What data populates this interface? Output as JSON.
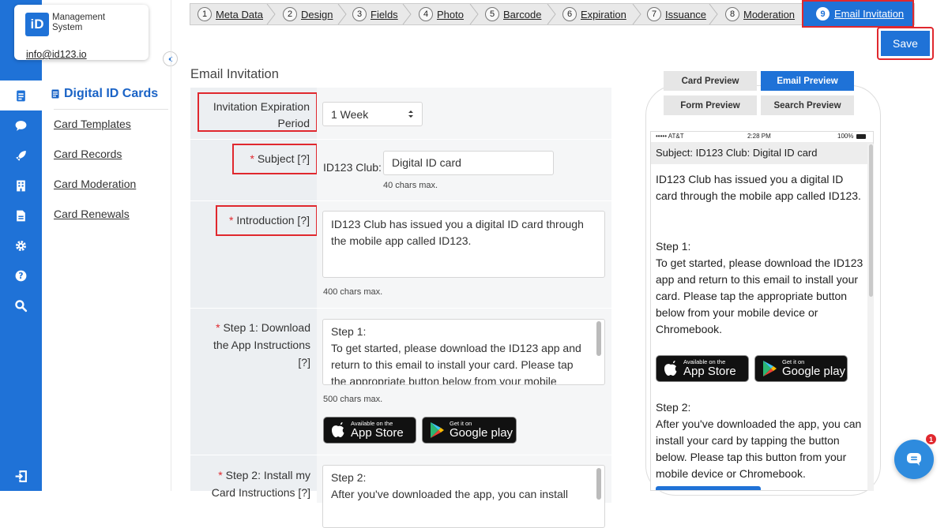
{
  "brand": {
    "logo_text": "iD",
    "title": "Management System",
    "email": "info@id123.io"
  },
  "rail": {
    "icons": [
      "card-icon",
      "chat-icon",
      "rocket-icon",
      "building-icon",
      "document-icon",
      "gear-icon",
      "help-icon",
      "search-icon",
      "logout-icon"
    ],
    "active": "card-icon",
    "bg_color": "#1f72d7"
  },
  "sidebar": {
    "heading": "Digital ID Cards",
    "items": [
      "Card Templates",
      "Card Records",
      "Card Moderation",
      "Card Renewals"
    ]
  },
  "steps": [
    {
      "num": "1",
      "label": "Meta Data"
    },
    {
      "num": "2",
      "label": "Design"
    },
    {
      "num": "3",
      "label": "Fields"
    },
    {
      "num": "4",
      "label": "Photo"
    },
    {
      "num": "5",
      "label": "Barcode"
    },
    {
      "num": "6",
      "label": "Expiration"
    },
    {
      "num": "7",
      "label": "Issuance"
    },
    {
      "num": "8",
      "label": "Moderation"
    },
    {
      "num": "9",
      "label": "Email Invitation"
    }
  ],
  "active_step": "9",
  "save_label": "Save",
  "section_title": "Email Invitation",
  "form": {
    "expiration": {
      "label": "Invitation Expiration Period",
      "value": "1 Week"
    },
    "subject": {
      "req": "*",
      "label": "Subject [?]",
      "prefix": "ID123 Club:",
      "value": "Digital ID card",
      "note": "40 chars max."
    },
    "introduction": {
      "req": "*",
      "label": "Introduction [?]",
      "value": "ID123 Club has issued you a digital ID card through the mobile app called ID123.",
      "note": "400 chars max."
    },
    "step1": {
      "req": "*",
      "label": "Step 1: Download the App Instructions [?]",
      "value": "Step 1:\nTo get started, please download the ID123 app and return to this email to install your card. Please tap the appropriate button below from your mobile",
      "note": "500 chars max."
    },
    "step2": {
      "req": "*",
      "label": "Step 2: Install my Card Instructions [?]",
      "value": "Step 2:\nAfter you've downloaded the app, you can install"
    }
  },
  "store_buttons": {
    "apple_small": "Available on the",
    "apple_big": "App Store",
    "google_small": "Get it on",
    "google_big": "Google play"
  },
  "preview": {
    "tabs": [
      "Card Preview",
      "Email Preview",
      "Form Preview",
      "Search Preview"
    ],
    "active_tab": "Email Preview",
    "status_carrier": "••••• AT&T",
    "status_time": "2:28 PM",
    "status_battery": "100%",
    "subject": "Subject: ID123 Club: Digital ID card",
    "intro": "ID123 Club has issued you a digital ID card through the mobile app called ID123.",
    "step1_title": "Step 1:",
    "step1_body": "To get started, please download the ID123 app and return to this email to install your card. Please tap the appropriate button below from your mobile device or Chromebook.",
    "step2_title": "Step 2:",
    "step2_body": "After you've downloaded the app, you can install your card by tapping the button below. Please tap this button from your mobile device or Chromebook."
  },
  "chat": {
    "badge": "1"
  },
  "colors": {
    "accent": "#1f72d7",
    "highlight": "#e0282e"
  }
}
